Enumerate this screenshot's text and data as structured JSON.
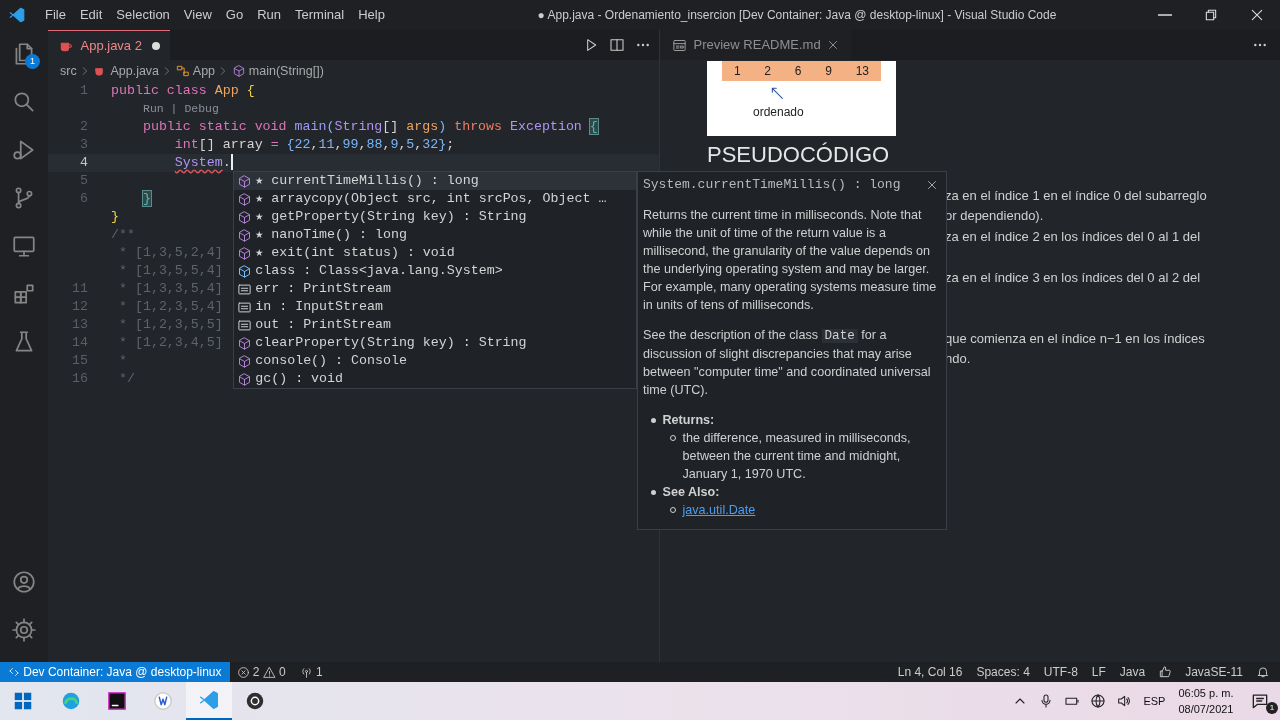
{
  "title_bar": {
    "menu": [
      "File",
      "Edit",
      "Selection",
      "View",
      "Go",
      "Run",
      "Terminal",
      "Help"
    ],
    "title": "● App.java - Ordenamiento_insercion [Dev Container: Java @ desktop-linux] - Visual Studio Code"
  },
  "activity_bar": {
    "top": [
      {
        "kind": "explorer",
        "badge": "1"
      },
      {
        "kind": "search"
      },
      {
        "kind": "run"
      },
      {
        "kind": "source-control"
      },
      {
        "kind": "remote"
      },
      {
        "kind": "extensions"
      },
      {
        "kind": "testing"
      }
    ],
    "bottom": [
      {
        "kind": "account"
      },
      {
        "kind": "settings"
      }
    ]
  },
  "editor": {
    "tab": {
      "label": "App.java",
      "problems": "2",
      "dirty": true
    },
    "breadcrumbs": [
      {
        "kind": "folder",
        "label": "src"
      },
      {
        "kind": "file",
        "label": "App.java"
      },
      {
        "kind": "class",
        "label": "App"
      },
      {
        "kind": "method",
        "label": "main(String[])"
      }
    ],
    "lines": [
      {
        "number": "1",
        "current": false,
        "tokens": [
          {
            "kind": "keyword",
            "text": "public class "
          },
          {
            "kind": "class",
            "text": "App"
          },
          {
            "kind": "brace",
            "text": " {"
          }
        ]
      },
      {
        "number": "2",
        "current": false,
        "codelens": "Run | Debug",
        "tokens": [
          {
            "kind": "keyword",
            "text": "    public static void "
          },
          {
            "kind": "fn",
            "text": "main"
          },
          {
            "kind": "paren",
            "text": "("
          },
          {
            "kind": "type",
            "text": "String"
          },
          {
            "kind": "plain",
            "text": "[] "
          },
          {
            "kind": "param",
            "text": "args"
          },
          {
            "kind": "paren",
            "text": ") "
          },
          {
            "kind": "throws",
            "text": "throws "
          },
          {
            "kind": "type",
            "text": "Exception "
          },
          {
            "kind": "match",
            "text": "{"
          }
        ]
      },
      {
        "number": "3",
        "current": false,
        "tokens": [
          {
            "kind": "keyword",
            "text": "        int"
          },
          {
            "kind": "plain",
            "text": "[] array "
          },
          {
            "kind": "keyword",
            "text": "= "
          },
          {
            "kind": "paren",
            "text": "{"
          },
          {
            "kind": "num",
            "text": "22"
          },
          {
            "kind": "plain",
            "text": ","
          },
          {
            "kind": "num",
            "text": "11"
          },
          {
            "kind": "plain",
            "text": ","
          },
          {
            "kind": "num",
            "text": "99"
          },
          {
            "kind": "plain",
            "text": ","
          },
          {
            "kind": "num",
            "text": "88"
          },
          {
            "kind": "plain",
            "text": ","
          },
          {
            "kind": "num",
            "text": "9"
          },
          {
            "kind": "plain",
            "text": ","
          },
          {
            "kind": "num",
            "text": "5"
          },
          {
            "kind": "plain",
            "text": ","
          },
          {
            "kind": "num",
            "text": "32"
          },
          {
            "kind": "paren",
            "text": "}"
          },
          {
            "kind": "plain",
            "text": ";"
          }
        ]
      },
      {
        "number": "4",
        "current": true,
        "tokens": [
          {
            "kind": "error",
            "text": "        System"
          },
          {
            "kind": "plain",
            "text": "."
          }
        ]
      },
      {
        "number": "5",
        "current": false
      },
      {
        "number": "6",
        "current": false,
        "tokens": [
          {
            "kind": "match",
            "text": "    }"
          }
        ]
      },
      {
        "current": false,
        "tokens": [
          {
            "kind": "brace",
            "text": "}"
          }
        ]
      },
      {
        "current": false,
        "tokens": [
          {
            "kind": "comment",
            "text": "/**"
          }
        ]
      },
      {
        "current": false,
        "tokens": [
          {
            "kind": "comment",
            "text": " * [1,3,5,2,4]"
          }
        ]
      },
      {
        "current": false,
        "tokens": [
          {
            "kind": "comment",
            "text": " * [1,3,5,5,4]"
          }
        ]
      },
      {
        "number": "11",
        "current": false,
        "tokens": [
          {
            "kind": "comment",
            "text": " * [1,3,3,5,4]"
          }
        ]
      },
      {
        "number": "12",
        "current": false,
        "tokens": [
          {
            "kind": "comment",
            "text": " * [1,2,3,5,4]"
          }
        ]
      },
      {
        "number": "13",
        "current": false,
        "tokens": [
          {
            "kind": "comment",
            "text": " * [1,2,3,5,5]"
          }
        ]
      },
      {
        "number": "14",
        "current": false,
        "tokens": [
          {
            "kind": "comment",
            "text": " * [1,2,3,4,5]"
          }
        ]
      },
      {
        "number": "15",
        "current": false,
        "tokens": [
          {
            "kind": "comment",
            "text": " *"
          }
        ]
      },
      {
        "number": "16",
        "current": false,
        "tokens": [
          {
            "kind": "comment",
            "text": " */"
          }
        ]
      }
    ]
  },
  "suggest": {
    "items": [
      {
        "kind": "method",
        "label": "★ currentTimeMillis() : long",
        "selected": true
      },
      {
        "kind": "method",
        "label": "★ arraycopy(Object src, int srcPos, Object …",
        "selected": false
      },
      {
        "kind": "method",
        "label": "★ getProperty(String key) : String",
        "selected": false
      },
      {
        "kind": "method",
        "label": "★ nanoTime() : long",
        "selected": false
      },
      {
        "kind": "method",
        "label": "★ exit(int status) : void",
        "selected": false
      },
      {
        "kind": "class",
        "label": "class : Class<java.lang.System>",
        "selected": false
      },
      {
        "kind": "field",
        "label": "err : PrintStream",
        "selected": false
      },
      {
        "kind": "field",
        "label": "in : InputStream",
        "selected": false
      },
      {
        "kind": "field",
        "label": "out : PrintStream",
        "selected": false
      },
      {
        "kind": "method",
        "label": "clearProperty(String key) : String",
        "selected": false
      },
      {
        "kind": "method",
        "label": "console() : Console",
        "selected": false
      },
      {
        "kind": "method",
        "label": "gc() : void",
        "selected": false
      }
    ]
  },
  "hover": {
    "signature": "System.currentTimeMillis() : long",
    "paragraphs": [
      [
        {
          "kind": "text",
          "text": "Returns the current time in milliseconds. Note that while the unit of time of the return value is a millisecond, the granularity of the value depends on the underlying operating system and may be larger. For example, many operating systems measure time in units of tens of milliseconds."
        }
      ],
      [
        {
          "kind": "text",
          "text": "See the description of the class "
        },
        {
          "kind": "code",
          "text": "Date"
        },
        {
          "kind": "text",
          "text": " for a discussion of slight discrepancies that may arise between \"computer time\" and coordinated universal time (UTC)."
        }
      ]
    ],
    "sections": [
      {
        "label": "Returns:",
        "items": [
          {
            "kind": "text",
            "text": "the difference, measured in milliseconds, between the current time and midnight, January 1, 1970 UTC."
          }
        ]
      },
      {
        "label": "See Also:",
        "items": [
          {
            "kind": "link",
            "text": "java.util.Date"
          }
        ]
      }
    ]
  },
  "preview": {
    "tab": "Preview README.md",
    "image": {
      "cells": [
        "1",
        "2",
        "6",
        "9",
        "13"
      ],
      "caption": "ordenado"
    },
    "heading": "PSEUDOCÓDIGO",
    "fragments": [
      [
        "za en el índice 1 en el índice 0 del subarreglo",
        "or dependiendo)."
      ],
      [
        "za en el índice 2 en los índices del 0 al 1 del"
      ],
      [
        "za en el índice 3 en los índices del 0 al 2 del"
      ],
      [
        "que comienza en el índice n−1 en los índices",
        "ndo."
      ]
    ]
  },
  "status_bar": {
    "remote": "Dev Container: Java @ desktop-linux",
    "errors": "2",
    "warnings": "0",
    "ports": "1",
    "items": [
      "Ln 4, Col 16",
      "Spaces: 4",
      "UTF-8",
      "LF",
      "Java"
    ],
    "version": "JavaSE-11"
  },
  "taskbar": {
    "apps": [
      {
        "kind": "start",
        "active": false
      },
      {
        "kind": "browser",
        "active": false
      },
      {
        "kind": "ide",
        "active": false
      },
      {
        "kind": "writer",
        "active": false
      },
      {
        "kind": "code",
        "active": true
      },
      {
        "kind": "recorder",
        "active": false
      }
    ],
    "language": "ESP",
    "time": "06:05 p. m.",
    "date": "08/07/2021",
    "notifications": "1"
  }
}
